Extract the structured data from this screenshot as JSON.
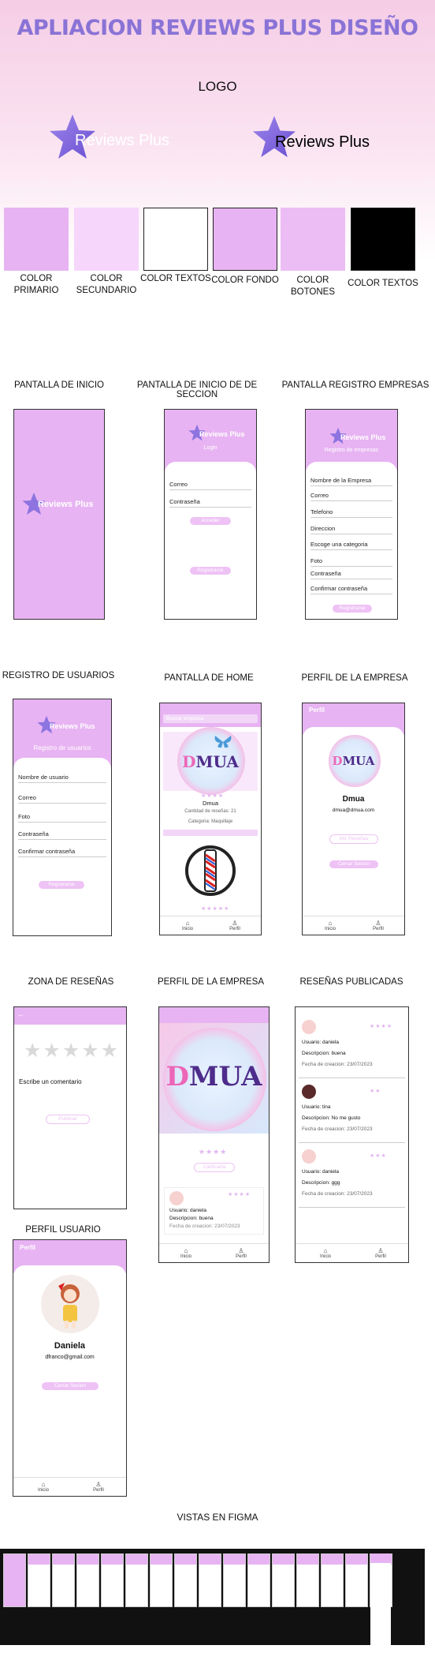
{
  "title": "APLIACION REVIEWS PLUS DISEÑO",
  "logo_section": {
    "label": "LOGO",
    "brand_name_light": "Reviews Plus",
    "brand_name_dark": "Reviews Plus"
  },
  "palette": [
    {
      "color": "#e7b3f2",
      "label": "COLOR PRIMARIO"
    },
    {
      "color": "#f6d6fb",
      "label": "COLOR SECUNDARIO"
    },
    {
      "color": "#ffffff",
      "label": "COLOR TEXTOS"
    },
    {
      "color": "#e7b3f2",
      "label": "COLOR FONDO"
    },
    {
      "color": "#ecbdf5",
      "label": "COLOR BOTONES"
    },
    {
      "color": "#000000",
      "label": "COLOR TEXTOS"
    }
  ],
  "screens": {
    "inicio": {
      "label": "PANTALLA DE INICIO",
      "brand": "Reviews Plus"
    },
    "login": {
      "label": "PANTALLA DE INICIO DE DE SECCION",
      "brand": "Reviews Plus",
      "subtitle": "Login",
      "fields": [
        "Correo",
        "Contraseña"
      ],
      "button": "Acceder",
      "button2": "Registrarse"
    },
    "registro_empresas": {
      "label": "PANTALLA REGISTRO EMPRESAS",
      "brand": "Reviews Plus",
      "subtitle": "Registro de empresas",
      "fields": [
        "Nombre de la Empresa",
        "Correo",
        "Telefono",
        "Direccion",
        "Escoge una categoria",
        "Foto",
        "Contraseña",
        "Confirmar contraseña"
      ],
      "button": "Registrarse"
    },
    "registro_usuarios": {
      "label": "REGISTRO DE USUARIOS",
      "brand": "Reviews Plus",
      "subtitle": "Registro de usuarios",
      "fields": [
        "Nombre de usuario",
        "Correo",
        "Foto",
        "Contraseña",
        "Confirmar contraseña"
      ],
      "button": "Registrarse"
    },
    "home": {
      "label": "PANTALLA DE HOME",
      "search_placeholder": "Buscar empresa",
      "business_name": "Dmua",
      "reviews_count": "Cantidad de reseñas: 21",
      "category": "Categoria: Maquillaje",
      "nav": [
        "Inicio",
        "Perfil"
      ]
    },
    "perfil_empresa": {
      "label": "PERFIL DE LA EMPRESA",
      "header": "Perfil",
      "name": "Dmua",
      "email": "dmua@dmua.com",
      "button_reviews": "Ver Reseñas",
      "button_logout": "Cerrar Sesion",
      "nav": [
        "Inicio",
        "Perfil"
      ]
    },
    "zona_resenas": {
      "label": "ZONA DE RESEÑAS",
      "comment_label": "Escribe un comentario",
      "button": "Publicar"
    },
    "perfil_empresa_2": {
      "label": "PERFIL DE LA EMPRESA",
      "button": "Calificarla",
      "review": {
        "user": "Usuario: daniela",
        "description": "Descripcion: buena",
        "date": "Fecha de creacion: 23/07/2023"
      },
      "nav": [
        "Inicio",
        "Perfil"
      ]
    },
    "resenas_publicadas": {
      "label": "RESEÑAS PUBLICADAS",
      "reviews": [
        {
          "user": "Usuario: daniela",
          "description": "Descripcion: buena",
          "date": "Fecha de creacion: 23/07/2023"
        },
        {
          "user": "Usuario: tina",
          "description": "Descripcion: No me gusto",
          "date": "Fecha de creacion: 23/07/2023"
        },
        {
          "user": "Usuario: daniela",
          "description": "Descripcion: ggg",
          "date": "Fecha de creacion: 23/07/2023"
        }
      ],
      "nav": [
        "Inicio",
        "Perfil"
      ]
    },
    "perfil_usuario": {
      "label": "PERFIL USUARIO",
      "header": "Perfil",
      "name": "Daniela",
      "email": "dfranco@gmail.com",
      "button": "Cerrar Sesion",
      "nav": [
        "Inicio",
        "Perfil"
      ]
    }
  },
  "figma": {
    "label": "VISTAS EN FIGMA"
  }
}
